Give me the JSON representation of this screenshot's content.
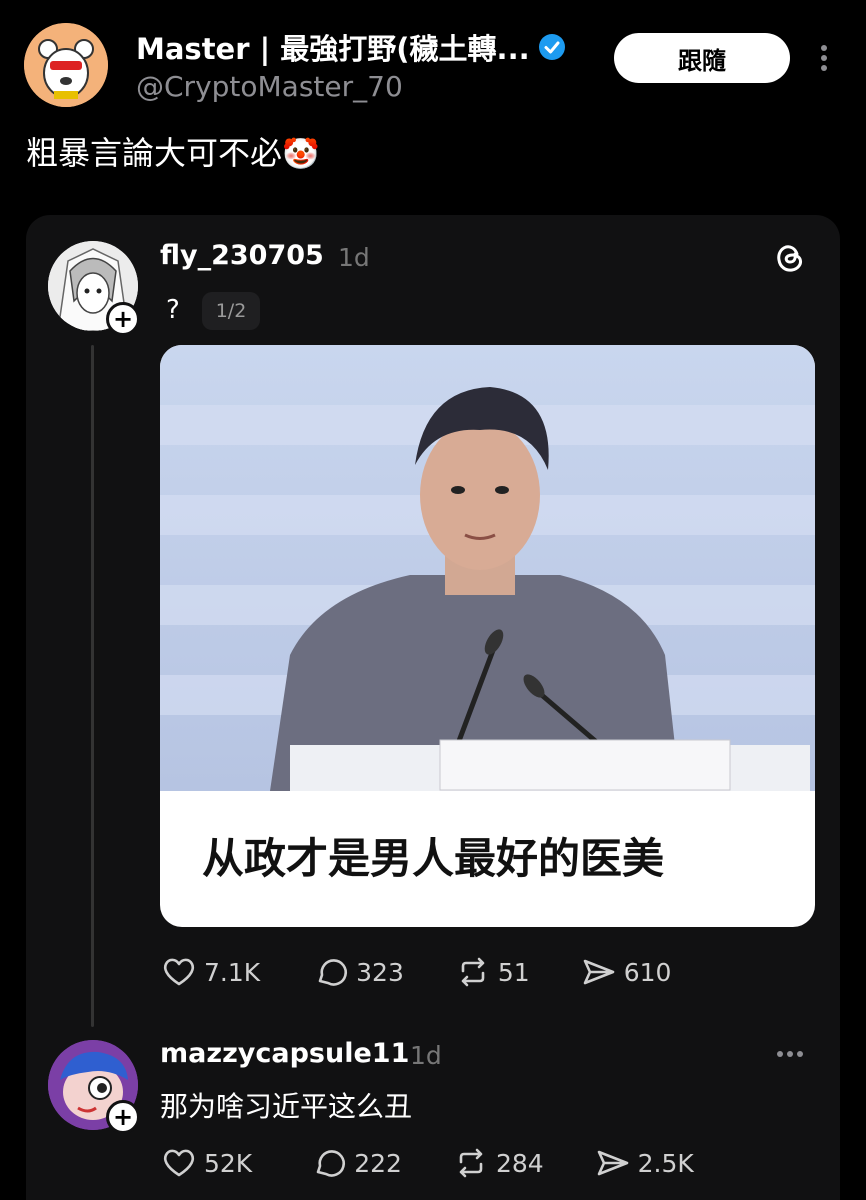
{
  "tweet": {
    "author_name": "Master | 最強打野(穢土轉...",
    "author_handle": "@CryptoMaster_70",
    "follow_label": "跟隨",
    "text": "粗暴言論大可不必",
    "text_emoji": "🤡"
  },
  "embed": {
    "post": {
      "username": "fly_230705",
      "time": "1d",
      "text": "?",
      "page_indicator": "1/2",
      "image_caption": "从政才是男人最好的医美",
      "stats": {
        "likes": "7.1K",
        "replies": "323",
        "reposts": "51",
        "shares": "610"
      }
    },
    "reply": {
      "username": "mazzycapsule11",
      "time": "1d",
      "text": "那为啥习近平这么丑",
      "stats": {
        "likes": "52K",
        "replies": "222",
        "reposts": "284",
        "shares": "2.5K"
      }
    }
  },
  "colors": {
    "background": "#000000",
    "card": "#111112",
    "verified": "#1d9bf0",
    "muted": "#8e8e93"
  }
}
